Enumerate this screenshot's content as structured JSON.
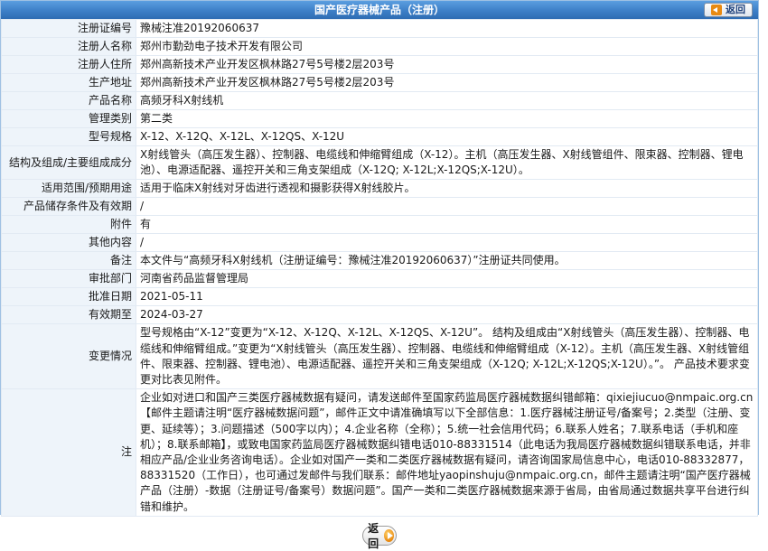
{
  "header": {
    "title": "国产医疗器械产品（注册）",
    "back_label": "返回"
  },
  "fields": [
    {
      "label": "注册证编号",
      "value": "豫械注准20192060637"
    },
    {
      "label": "注册人名称",
      "value": "郑州市勤劲电子技术开发有限公司"
    },
    {
      "label": "注册人住所",
      "value": "郑州高新技术产业开发区枫林路27号5号楼2层203号"
    },
    {
      "label": "生产地址",
      "value": "郑州高新技术产业开发区枫林路27号5号楼2层203号"
    },
    {
      "label": "产品名称",
      "value": "高频牙科X射线机"
    },
    {
      "label": "管理类别",
      "value": "第二类"
    },
    {
      "label": "型号规格",
      "value": "X-12、X-12Q、X-12L、X-12QS、X-12U"
    },
    {
      "label": "结构及组成/主要组成成分",
      "value": "X射线管头（高压发生器）、控制器、电缆线和伸缩臂组成（X-12）。主机（高压发生器、X射线管组件、限束器、控制器、锂电池）、电源适配器、遥控开关和三角支架组成（X-12Q; X-12L;X-12QS;X-12U）。"
    },
    {
      "label": "适用范围/预期用途",
      "value": "适用于临床X射线对牙齿进行透视和摄影获得X射线胶片。"
    },
    {
      "label": "产品储存条件及有效期",
      "value": "/"
    },
    {
      "label": "附件",
      "value": "有"
    },
    {
      "label": "其他内容",
      "value": "/"
    },
    {
      "label": "备注",
      "value": "本文件与“高频牙科X射线机（注册证编号：豫械注准20192060637）”注册证共同使用。"
    },
    {
      "label": "审批部门",
      "value": "河南省药品监督管理局"
    },
    {
      "label": "批准日期",
      "value": "2021-05-11"
    },
    {
      "label": "有效期至",
      "value": "2024-03-27"
    },
    {
      "label": "变更情况",
      "value": "型号规格由“X-12”变更为“X-12、X-12Q、X-12L、X-12QS、X-12U”。 结构及组成由“X射线管头（高压发生器）、控制器、电缆线和伸缩臂组成。”变更为“X射线管头（高压发生器）、控制器、电缆线和伸缩臂组成（X-12）。主机（高压发生器、X射线管组件、限束器、控制器、锂电池）、电源适配器、遥控开关和三角支架组成（X-12Q; X-12L;X-12QS;X-12U）。”。 产品技术要求变更对比表见附件。"
    },
    {
      "label": "注",
      "value": "企业如对进口和国产三类医疗器械数据有疑问，请发送邮件至国家药监局医疗器械数据纠错邮箱：qixiejiucuo@nmpaic.org.cn【邮件主题请注明“医疗器械数据问题”，邮件正文中请准确填写以下全部信息：1.医疗器械注册证号/备案号；2.类型（注册、变更、延续等）；3.问题描述（500字以内）；4.企业名称（全称）；5.统一社会信用代码；6.联系人姓名；7.联系电话（手机和座机）；8.联系邮箱】，或致电国家药监局医疗器械数据纠错电话010-88331514（此电话为我局医疗器械数据纠错联系电话，并非相应产品/企业业务咨询电话）。企业如对国产一类和二类医疗器械数据有疑问，请咨询国家局信息中心，电话010-88332877，88331520（工作日），也可通过发邮件与我们联系：邮件地址yaopinshuju@nmpaic.org.cn，邮件主题请注明“国产医疗器械产品（注册）-数据（注册证号/备案号）数据问题”。国产一类和二类医疗器械数据来源于省局，由省局通过数据共享平台进行纠错和维护。"
    }
  ],
  "footer": {
    "back_label": "返回"
  }
}
